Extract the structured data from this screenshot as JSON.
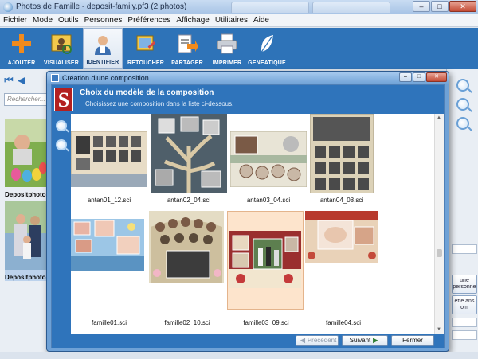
{
  "app": {
    "title": "Photos de Famille - deposit-family.pf3 (2 photos)",
    "window_buttons": [
      "–",
      "□",
      "✕"
    ]
  },
  "menu": [
    "Fichier",
    "Mode",
    "Outils",
    "Personnes",
    "Préférences",
    "Affichage",
    "Utilitaires",
    "Aide"
  ],
  "toolbar": {
    "buttons": [
      {
        "label": "AJOUTER",
        "icon": "plus-icon"
      },
      {
        "label": "VISUALISER",
        "icon": "photo-view-icon"
      },
      {
        "label": "IDENTIFIER",
        "icon": "person-identify-icon",
        "active": true
      },
      {
        "label": "RETOUCHER",
        "icon": "retouch-icon"
      },
      {
        "label": "PARTAGER",
        "icon": "share-icon"
      },
      {
        "label": "IMPRIMER",
        "icon": "printer-icon"
      },
      {
        "label": "GENEATIQUE",
        "icon": "feather-icon"
      }
    ]
  },
  "left_panel": {
    "search_placeholder": "Rechercher...",
    "thumbnails": [
      {
        "caption": "Depositphotos"
      },
      {
        "caption": "Depositphotos"
      }
    ]
  },
  "right_panel": {
    "buttons": [
      "une\npersonne",
      "ette\nans\nom"
    ]
  },
  "dialog": {
    "title": "Création d'une composition",
    "header_title": "Choix du modèle de la composition",
    "header_subtitle": "Choisissez une composition dans la liste ci-dessous.",
    "logo_letter": "S",
    "templates": [
      {
        "name": "antan01_12.sci"
      },
      {
        "name": "antan02_04.sci"
      },
      {
        "name": "antan03_04.sci"
      },
      {
        "name": "antan04_08.sci"
      },
      {
        "name": "famille01.sci"
      },
      {
        "name": "famille02_10.sci"
      },
      {
        "name": "famille03_09.sci",
        "selected": true
      },
      {
        "name": "famille04.sci"
      }
    ],
    "buttons": {
      "previous": "Précédent",
      "next": "Suivant",
      "close": "Fermer"
    }
  }
}
